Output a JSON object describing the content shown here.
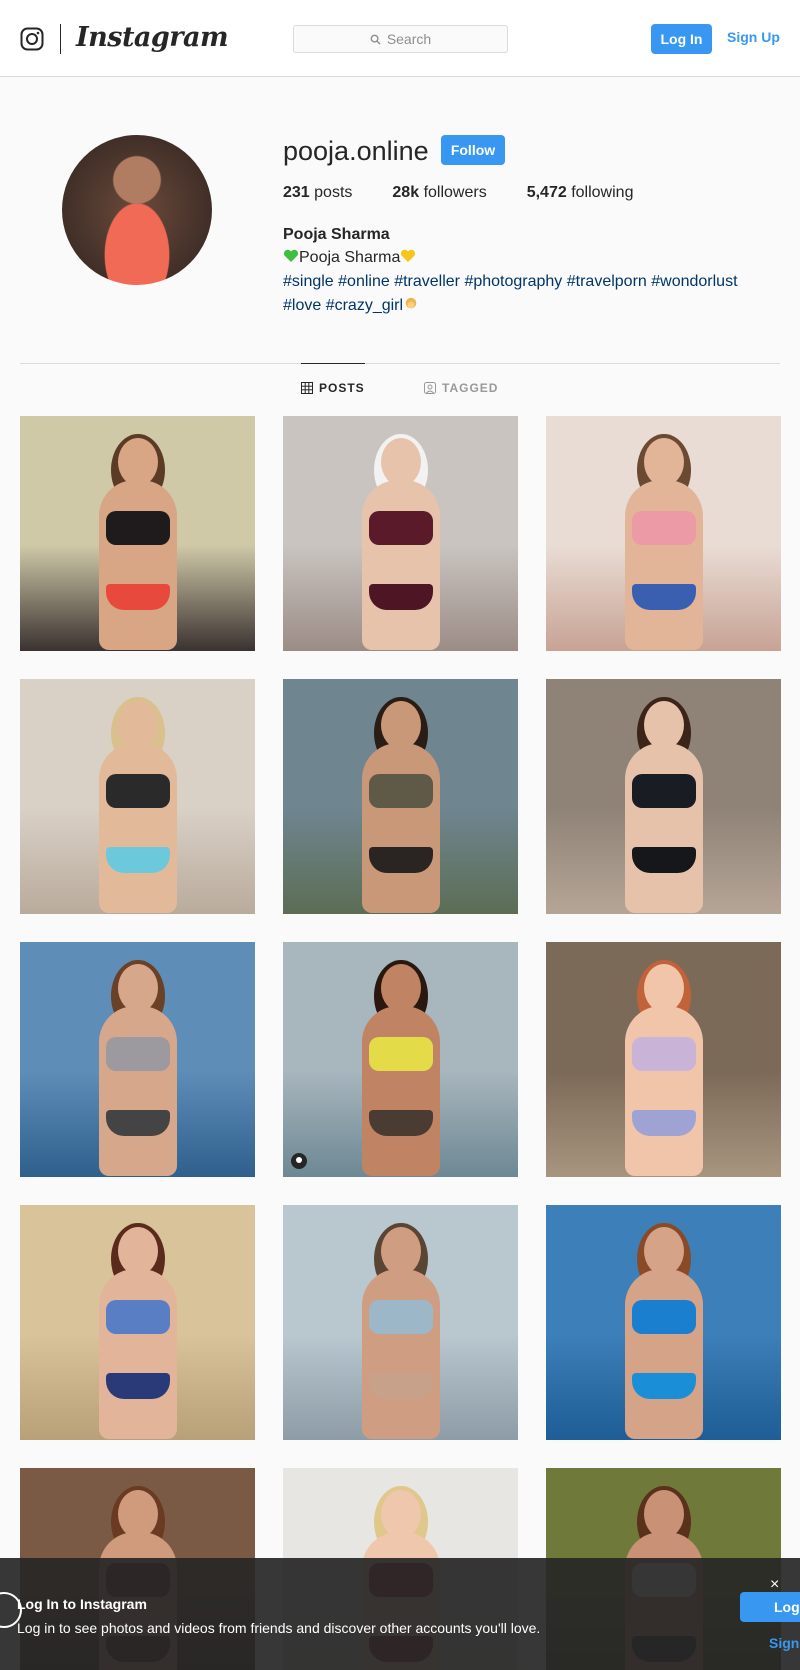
{
  "nav": {
    "wordmark": "Instagram",
    "search_placeholder": "Search",
    "login_label": "Log In",
    "signup_label": "Sign Up"
  },
  "profile": {
    "username": "pooja.online",
    "follow_label": "Follow",
    "stats": [
      {
        "count": "231",
        "label": "posts"
      },
      {
        "count": "28k",
        "label": "followers"
      },
      {
        "count": "5,472",
        "label": "following"
      }
    ],
    "full_name": "Pooja Sharma",
    "bio_name": "Pooja Sharma",
    "bio_tags_line1": "#single #online #traveller #photography #travelporn #wondorlust",
    "bio_tags_line2": "#love #crazy_girl",
    "link_color": "#003569"
  },
  "tabs": [
    {
      "label": "POSTS",
      "active": true
    },
    {
      "label": "TAGGED",
      "active": false
    }
  ],
  "posts": [
    {
      "bg": "#cfc9a8",
      "bg2": "#3a3230",
      "skin": "#d8a585",
      "hair": "#5b3b25",
      "top": "#1d1b1c",
      "bottom": "#e8493d",
      "tagged": false
    },
    {
      "bg": "#c9c4c0",
      "bg2": "#9c8c86",
      "skin": "#e7c3ab",
      "hair": "#f2f2f2",
      "top": "#5a1a2a",
      "bottom": "#4e1525",
      "tagged": false
    },
    {
      "bg": "#e9dcd5",
      "bg2": "#c7a394",
      "skin": "#e2b498",
      "hair": "#6a4a33",
      "top": "#ec9aa6",
      "bottom": "#3a5fb0",
      "tagged": false
    },
    {
      "bg": "#d9d0c6",
      "bg2": "#b9ab9c",
      "skin": "#e2ba9a",
      "hair": "#d9c08c",
      "top": "#2a2a2a",
      "bottom": "#6cc9dc",
      "tagged": false
    },
    {
      "bg": "#6f8590",
      "bg2": "#5c6d54",
      "skin": "#c99878",
      "hair": "#2a1d16",
      "top": "#5f5a47",
      "bottom": "#2a2422",
      "tagged": false
    },
    {
      "bg": "#8f8377",
      "bg2": "#b5a596",
      "skin": "#e6c2aa",
      "hair": "#3c2418",
      "top": "#1a1c24",
      "bottom": "#16171b",
      "tagged": false
    },
    {
      "bg": "#5e8db8",
      "bg2": "#2f5f8c",
      "skin": "#d7a78b",
      "hair": "#6a4026",
      "top": "#9c9a9e",
      "bottom": "#444",
      "tagged": false
    },
    {
      "bg": "#a8b6bd",
      "bg2": "#6d8894",
      "skin": "#c08464",
      "hair": "#2a1810",
      "top": "#e3dc48",
      "bottom": "#4a3b33",
      "tagged": true
    },
    {
      "bg": "#7c6a58",
      "bg2": "#a8957f",
      "skin": "#f0c5aa",
      "hair": "#c0633a",
      "top": "#c9b3d6",
      "bottom": "#9fa3d4",
      "tagged": false
    },
    {
      "bg": "#d9c39a",
      "bg2": "#b8a079",
      "skin": "#e2b59a",
      "hair": "#5a2b1d",
      "top": "#5a7ec4",
      "bottom": "#2a3a78",
      "tagged": false
    },
    {
      "bg": "#b9c7cf",
      "bg2": "#8d9ca6",
      "skin": "#cf9e82",
      "hair": "#5a4433",
      "top": "#9cb8c8",
      "bottom": "#c8a18a",
      "tagged": false
    },
    {
      "bg": "#3d7fb8",
      "bg2": "#1e5d96",
      "skin": "#d5a387",
      "hair": "#8a4a26",
      "top": "#1a7fcf",
      "bottom": "#1a8fd8",
      "tagged": false
    },
    {
      "bg": "#7a5a44",
      "bg2": "#3c2c20",
      "skin": "#d09a7c",
      "hair": "#6a3b22",
      "top": "#7a2a2a",
      "bottom": "#4a2a22",
      "tagged": false
    },
    {
      "bg": "#e8e6e3",
      "bg2": "#c9c6c1",
      "skin": "#efc7ac",
      "hair": "#e0c78c",
      "top": "#b52838",
      "bottom": "#8a1a2a",
      "tagged": false
    },
    {
      "bg": "#6f7a3a",
      "bg2": "#3e4a22",
      "skin": "#c99277",
      "hair": "#5a321c",
      "top": "#f3f3f3",
      "bottom": "#2a2a2a",
      "tagged": false
    }
  ],
  "banner": {
    "title": "Log In to Instagram",
    "text": "Log in to see photos and videos from friends and discover other accounts you'll love.",
    "close_label": "×",
    "login_label": "Log In",
    "signup_label": "Sign Up"
  },
  "colors": {
    "accent": "#3897f0",
    "heart_green": "#3fbf3f",
    "heart_yellow": "#f5c518"
  },
  "icons": {
    "logo": "instagram-glyph-icon",
    "search": "search-icon",
    "posts_tab": "grid-icon",
    "tagged_tab": "tagged-person-icon",
    "tagged_badge": "person-tag-icon",
    "banner": "instagram-glyph-icon",
    "close": "close-icon"
  }
}
